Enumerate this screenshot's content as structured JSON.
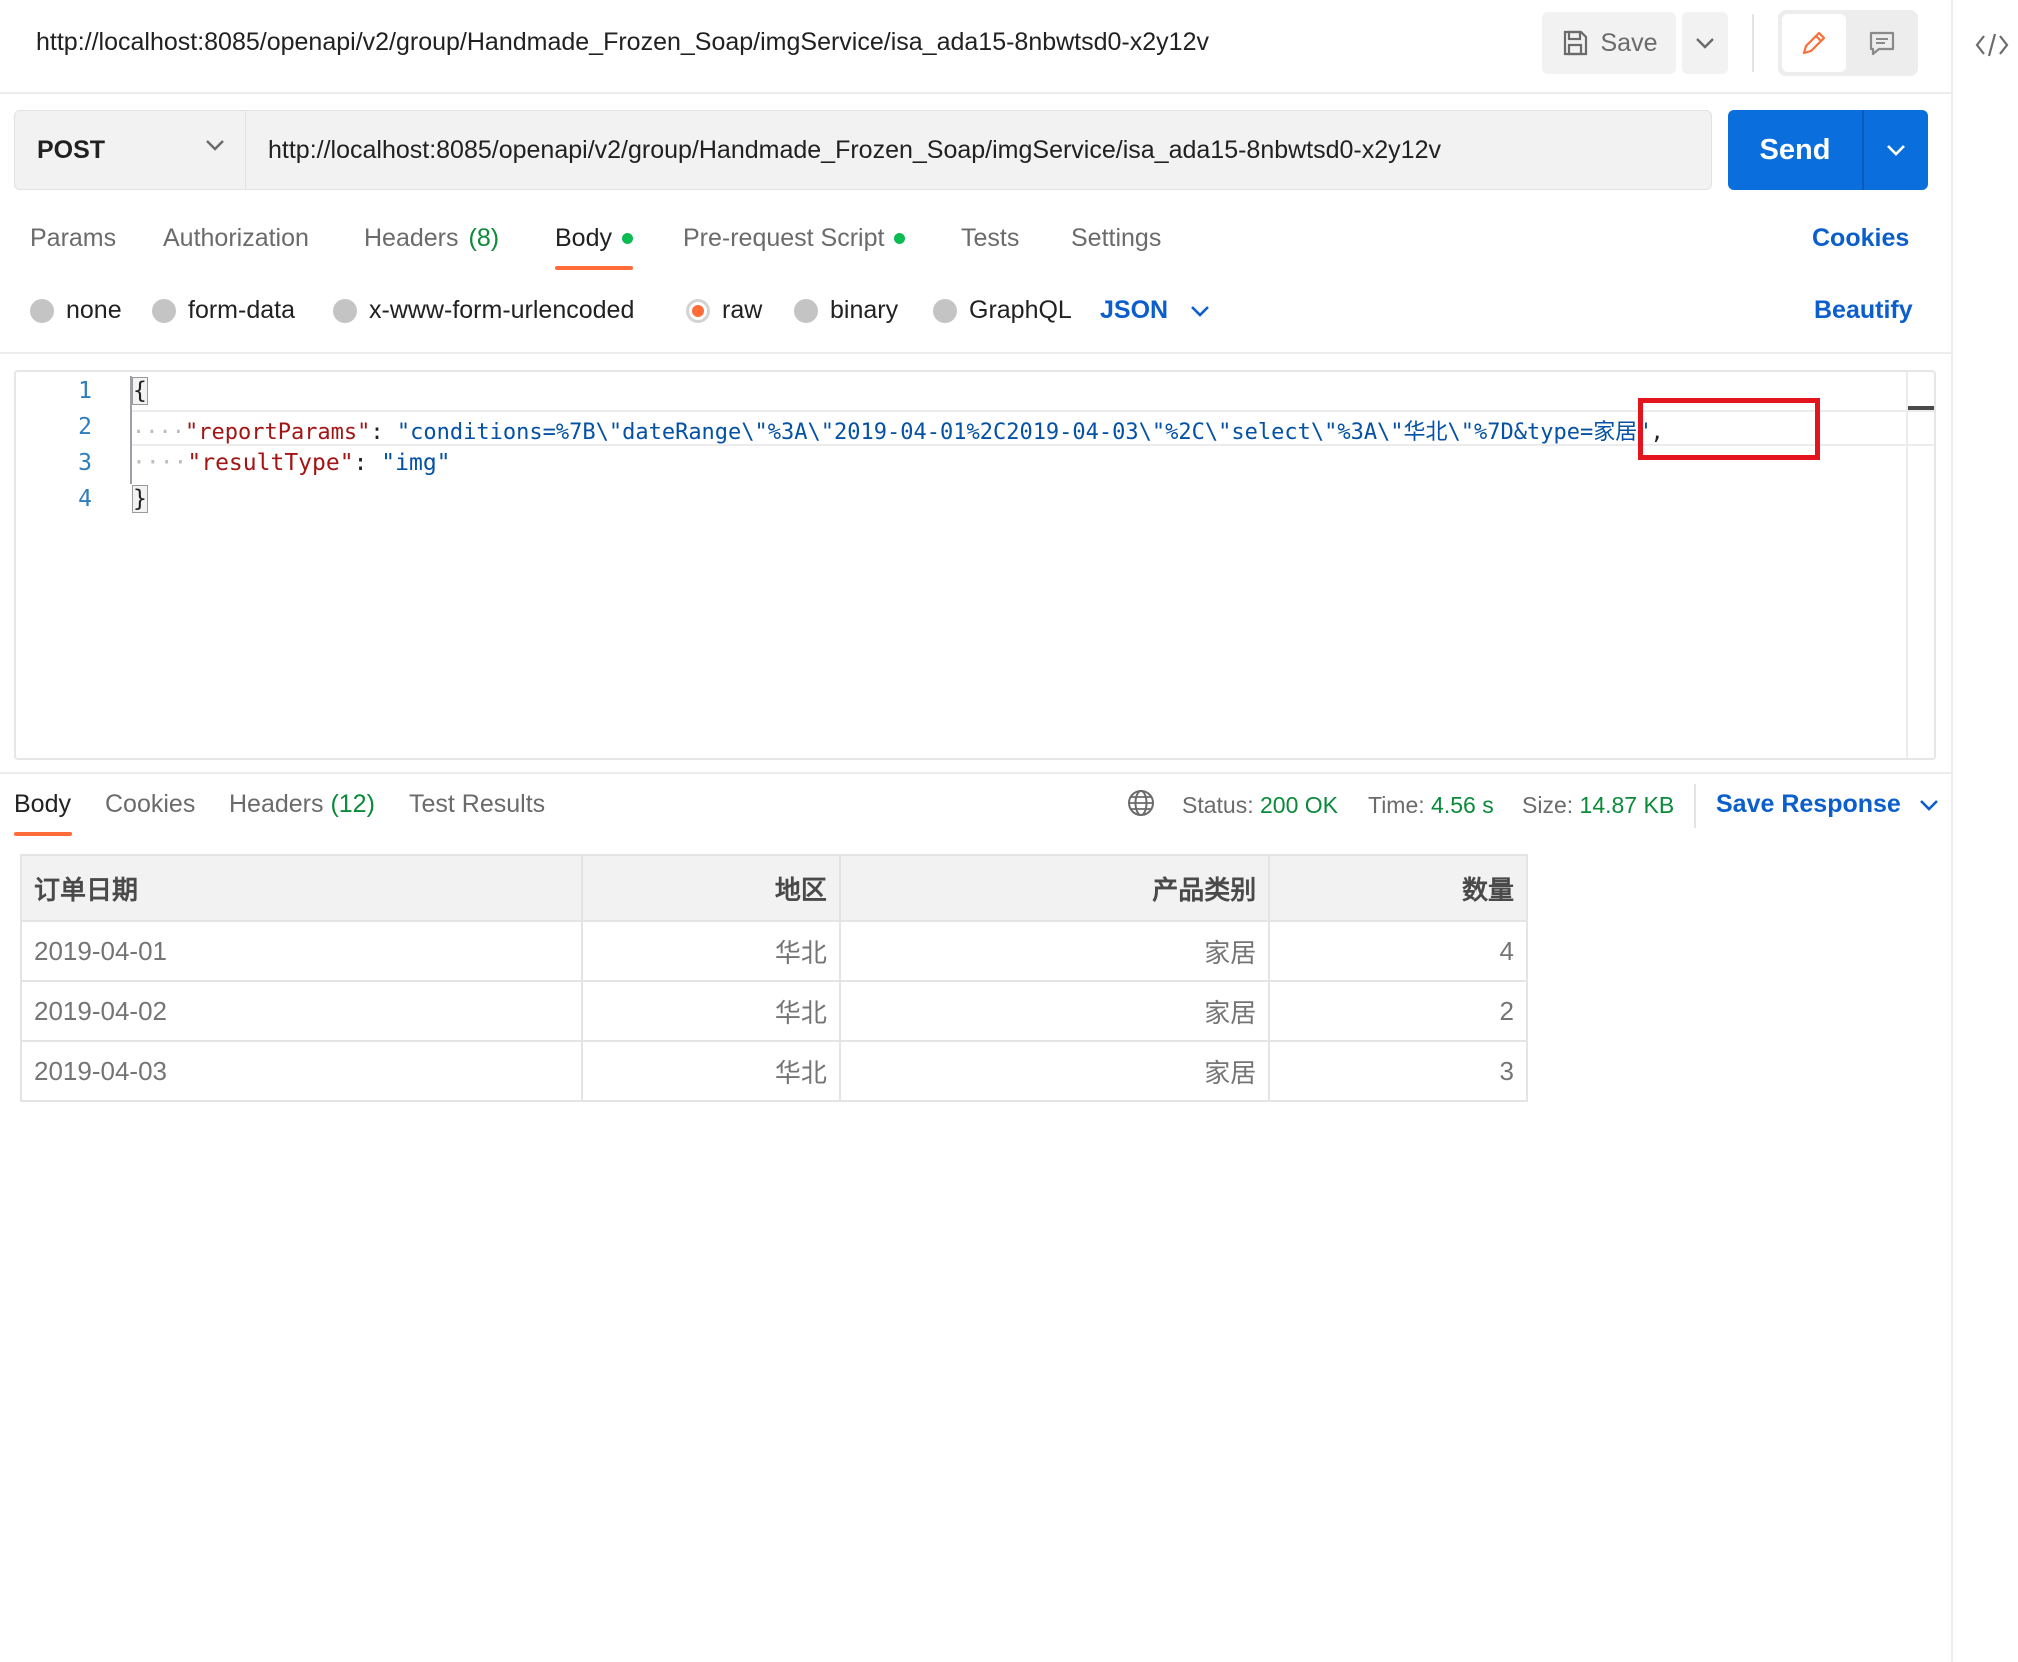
{
  "header": {
    "title": "http://localhost:8085/openapi/v2/group/Handmade_Frozen_Soap/imgService/isa_ada15-8nbwtsd0-x2y12v",
    "save_label": "Save"
  },
  "request": {
    "method": "POST",
    "url": "http://localhost:8085/openapi/v2/group/Handmade_Frozen_Soap/imgService/isa_ada15-8nbwtsd0-x2y12v",
    "send_label": "Send"
  },
  "request_tabs": {
    "params": "Params",
    "authorization": "Authorization",
    "headers": "Headers",
    "headers_count": "(8)",
    "body": "Body",
    "prerequest": "Pre-request Script",
    "tests": "Tests",
    "settings": "Settings",
    "cookies": "Cookies"
  },
  "body_types": {
    "none": "none",
    "form_data": "form-data",
    "urlencoded": "x-www-form-urlencoded",
    "raw": "raw",
    "binary": "binary",
    "graphql": "GraphQL",
    "selected": "raw",
    "format": "JSON",
    "beautify": "Beautify"
  },
  "editor": {
    "line_numbers": [
      "1",
      "2",
      "3",
      "4"
    ],
    "open_brace": "{",
    "close_brace": "}",
    "indent": "····",
    "key1": "\"reportParams\"",
    "colon": ":",
    "val1": "\"conditions=%7B\\\"dateRange\\\"%3A\\\"2019-04-01%2C2019-04-03\\\"%2C\\\"select\\\"%3A\\\"华北\\\"%7D&type=家居\"",
    "comma": ",",
    "key2": "\"resultType\"",
    "val2": "\"img\""
  },
  "response_tabs": {
    "body": "Body",
    "cookies": "Cookies",
    "headers": "Headers",
    "headers_count": "(12)",
    "test_results": "Test Results"
  },
  "response_status": {
    "status_label": "Status:",
    "status_value": "200 OK",
    "time_label": "Time:",
    "time_value": "4.56 s",
    "size_label": "Size:",
    "size_value": "14.87 KB",
    "save_response": "Save Response"
  },
  "result_table": {
    "headers": [
      "订单日期",
      "地区",
      "产品类别",
      "数量"
    ],
    "rows": [
      [
        "2019-04-01",
        "华北",
        "家居",
        "4"
      ],
      [
        "2019-04-02",
        "华北",
        "家居",
        "2"
      ],
      [
        "2019-04-03",
        "华北",
        "家居",
        "3"
      ]
    ]
  },
  "colors": {
    "accent_orange": "#ff6c37",
    "send_blue": "#0a6fdc",
    "link_blue": "#0b5fcc",
    "status_green": "#0a8a3a",
    "highlight_red": "#e3141e"
  },
  "icons": {
    "save": "floppy-disk-icon",
    "edit": "pencil-icon",
    "comment": "comment-icon",
    "code": "code-icon",
    "globe": "globe-icon",
    "chevron": "chevron-down-icon"
  }
}
